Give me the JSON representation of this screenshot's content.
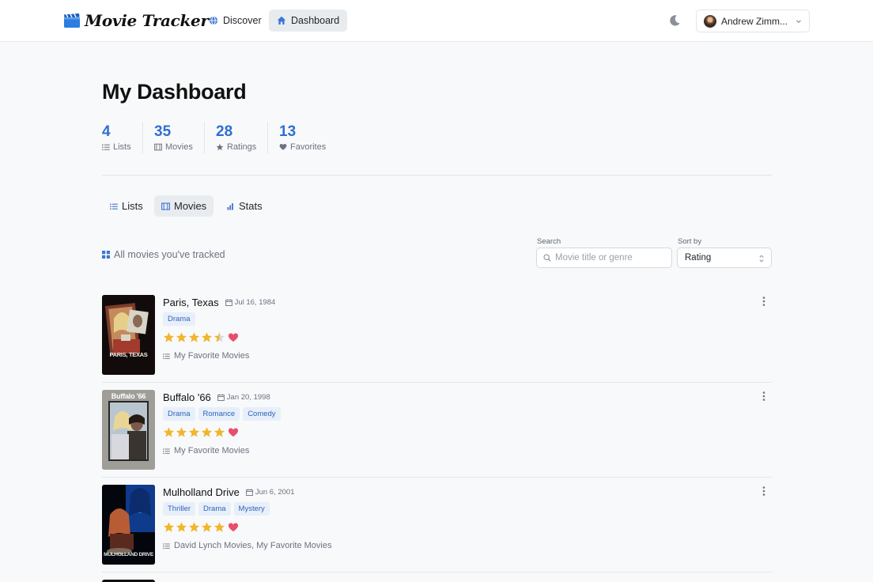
{
  "app": {
    "name": "Movie Tracker"
  },
  "nav": {
    "discover": "Discover",
    "dashboard": "Dashboard"
  },
  "user": {
    "name": "Andrew Zimm..."
  },
  "page": {
    "title": "My Dashboard"
  },
  "stats": [
    {
      "value": "4",
      "label": "Lists",
      "icon": "list-icon"
    },
    {
      "value": "35",
      "label": "Movies",
      "icon": "film-icon"
    },
    {
      "value": "28",
      "label": "Ratings",
      "icon": "star-icon"
    },
    {
      "value": "13",
      "label": "Favorites",
      "icon": "heart-icon"
    }
  ],
  "tabs": [
    {
      "label": "Lists",
      "icon": "list-icon",
      "active": false
    },
    {
      "label": "Movies",
      "icon": "film-icon",
      "active": true
    },
    {
      "label": "Stats",
      "icon": "bar-chart-icon",
      "active": false
    }
  ],
  "movies_section": {
    "label": "All movies you've tracked",
    "search_label": "Search",
    "search_placeholder": "Movie title or genre",
    "sort_label": "Sort by",
    "sort_value": "Rating"
  },
  "movies": [
    {
      "title": "Paris, Texas",
      "date": "Jul 16, 1984",
      "genres": [
        "Drama"
      ],
      "rating": 4.5,
      "favorite": true,
      "lists": "My Favorite Movies",
      "poster_caption": "PARIS, TEXAS"
    },
    {
      "title": "Buffalo '66",
      "date": "Jan 20, 1998",
      "genres": [
        "Drama",
        "Romance",
        "Comedy"
      ],
      "rating": 5,
      "favorite": true,
      "lists": "My Favorite Movies",
      "poster_caption": "Buffalo '66"
    },
    {
      "title": "Mulholland Drive",
      "date": "Jun 6, 2001",
      "genres": [
        "Thriller",
        "Drama",
        "Mystery"
      ],
      "rating": 5,
      "favorite": true,
      "lists": "David Lynch Movies, My Favorite Movies",
      "poster_caption": "MULHOLLAND DRIVE"
    }
  ],
  "colors": {
    "accent": "#2f6fd0",
    "star": "#f2b52b",
    "heart": "#e8506a",
    "genre_bg": "#e7effa",
    "genre_text": "#2f63b8"
  }
}
